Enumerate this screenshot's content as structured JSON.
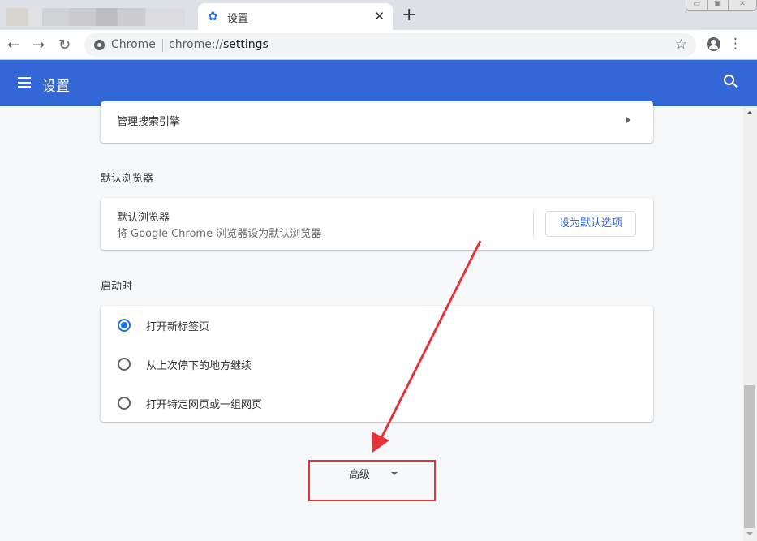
{
  "browser": {
    "tabs": [
      {
        "title": "",
        "blurred": true
      },
      {
        "title": "设置",
        "icon": "gear-icon",
        "active": true
      }
    ],
    "new_tab_label": "+",
    "tab_close_label": "✕",
    "window_controls": [
      "▭",
      "▣",
      "✕"
    ],
    "omnibox": {
      "site_chip": "Chrome",
      "url_scheme": "chrome://",
      "url_path": "settings"
    }
  },
  "appbar": {
    "title": "设置"
  },
  "sections": {
    "search_engine": {
      "manage_label": "管理搜索引擎"
    },
    "default_browser": {
      "section_title": "默认浏览器",
      "row_title": "默认浏览器",
      "row_subtitle": "将 Google Chrome 浏览器设为默认浏览器",
      "button_label": "设为默认选项"
    },
    "on_startup": {
      "section_title": "启动时",
      "options": [
        {
          "label": "打开新标签页",
          "checked": true
        },
        {
          "label": "从上次停下的地方继续",
          "checked": false
        },
        {
          "label": "打开特定网页或一组网页",
          "checked": false
        }
      ]
    },
    "advanced": {
      "label": "高级"
    }
  },
  "colors": {
    "accent": "#3367d6",
    "radio_checked": "#1a73e8",
    "annotation": "#e8323a"
  }
}
